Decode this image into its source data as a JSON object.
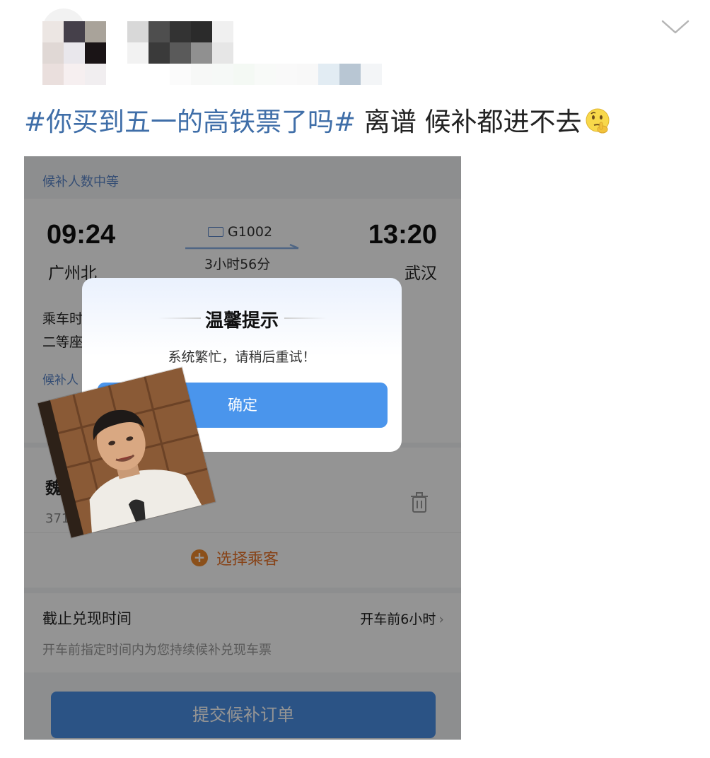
{
  "post": {
    "hashtag": "#你买到五一的高铁票了吗#",
    "text": " 离谱 候补都进不去",
    "emoji_icon": "thinking-face-icon"
  },
  "screenshot": {
    "waitlist_count_label": "候补人数中等",
    "train": {
      "departure_time": "09:24",
      "departure_station": "广州北",
      "train_number": "G1002",
      "duration": "3小时56分",
      "arrival_time": "13:20",
      "arrival_station": "武汉"
    },
    "info_line1": "乘车时",
    "info_line2": "二等座",
    "info_line3": "候补人",
    "passenger": {
      "name": "魏",
      "id_partial": "371"
    },
    "choose_passenger_label": "选择乘客",
    "deadline": {
      "title": "截止兑现时间",
      "value": "开车前6小时",
      "description": "开车前指定时间内为您持续候补兑现车票"
    },
    "submit_label": "提交候补订单",
    "dialog": {
      "title": "温馨提示",
      "message": "系统繁忙，请稍后重试！",
      "confirm_label": "确定"
    }
  },
  "colors": {
    "hashtag": "#3f6ea8",
    "primary_button": "#4a95ec",
    "accent_orange": "#e8742a"
  }
}
